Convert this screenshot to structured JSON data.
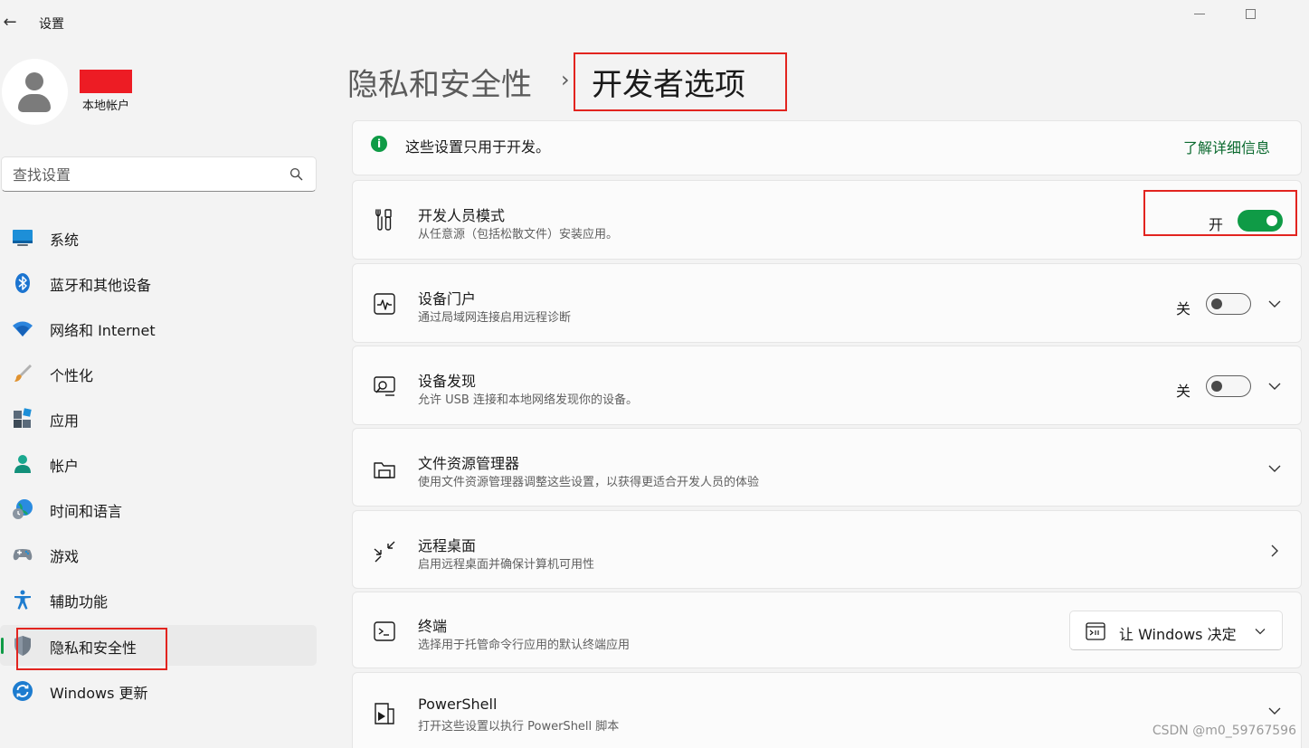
{
  "window": {
    "back_glyph": "←",
    "title": "设置"
  },
  "profile": {
    "account_type": "本地帐户"
  },
  "search": {
    "placeholder": "查找设置"
  },
  "nav": {
    "items": [
      {
        "label": "系统",
        "icon": "system-icon"
      },
      {
        "label": "蓝牙和其他设备",
        "icon": "bluetooth-icon"
      },
      {
        "label": "网络和 Internet",
        "icon": "wifi-icon"
      },
      {
        "label": "个性化",
        "icon": "brush-icon"
      },
      {
        "label": "应用",
        "icon": "apps-icon"
      },
      {
        "label": "帐户",
        "icon": "account-icon"
      },
      {
        "label": "时间和语言",
        "icon": "globe-clock-icon"
      },
      {
        "label": "游戏",
        "icon": "gamepad-icon"
      },
      {
        "label": "辅助功能",
        "icon": "accessibility-icon"
      },
      {
        "label": "隐私和安全性",
        "icon": "shield-icon"
      },
      {
        "label": "Windows 更新",
        "icon": "update-icon"
      }
    ],
    "active_index": 9
  },
  "header": {
    "parent": "隐私和安全性",
    "separator": "›",
    "current": "开发者选项"
  },
  "info_banner": {
    "icon_glyph": "i",
    "text": "这些设置只用于开发。",
    "link": "了解详细信息"
  },
  "settings": {
    "developer_mode": {
      "title": "开发人员模式",
      "desc": "从任意源（包括松散文件）安装应用。",
      "state_label": "开",
      "on": true
    },
    "device_portal": {
      "title": "设备门户",
      "desc": "通过局域网连接启用远程诊断",
      "state_label": "关",
      "on": false
    },
    "device_discovery": {
      "title": "设备发现",
      "desc": "允许 USB 连接和本地网络发现你的设备。",
      "state_label": "关",
      "on": false
    },
    "file_explorer": {
      "title": "文件资源管理器",
      "desc": "使用文件资源管理器调整这些设置，以获得更适合开发人员的体验"
    },
    "remote_desktop": {
      "title": "远程桌面",
      "desc": "启用远程桌面并确保计算机可用性"
    },
    "terminal": {
      "title": "终端",
      "desc": "选择用于托管命令行应用的默认终端应用",
      "dropdown_value": "让 Windows 决定"
    },
    "powershell": {
      "title": "PowerShell",
      "desc": "打开这些设置以执行 PowerShell 脚本"
    }
  },
  "colors": {
    "accent": "#0f9b46",
    "highlight_box": "#e2241f",
    "redaction": "#ed1c24"
  },
  "watermark": "CSDN @m0_59767596"
}
